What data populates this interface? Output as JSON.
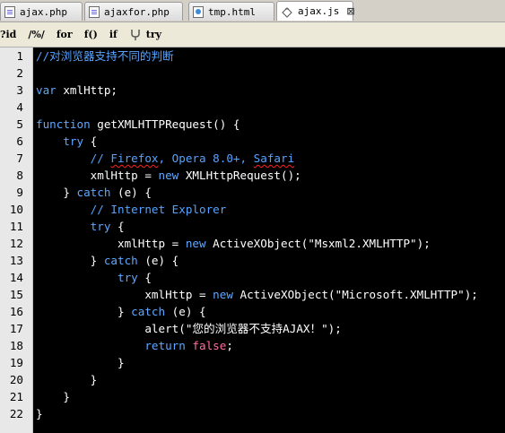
{
  "tabs": [
    {
      "name": "ajax.php",
      "icon": "php-file-icon"
    },
    {
      "name": "ajaxfor.php",
      "icon": "php-file-icon"
    },
    {
      "name": "tmp.html",
      "icon": "html-file-icon"
    },
    {
      "name": "ajax.js",
      "icon": "js-file-icon",
      "active": true,
      "close": "⊠"
    }
  ],
  "toolbar": [
    "?id",
    "/%/",
    "for",
    "f()",
    "if",
    "try"
  ],
  "line_numbers": [
    "1",
    "2",
    "3",
    "4",
    "5",
    "6",
    "7",
    "8",
    "9",
    "10",
    "11",
    "12",
    "13",
    "14",
    "15",
    "16",
    "17",
    "18",
    "19",
    "20",
    "21",
    "22"
  ],
  "code": {
    "l1": "//对浏览器支持不同的判断",
    "l3_kw": "var",
    "l3_rest": " xmlHttp;",
    "l5_kw": "function",
    "l5_rest": " getXMLHTTPRequest() {",
    "l6_kw": "try",
    "l6_rest": " {",
    "l7_a": "// ",
    "l7_b": "Firefox",
    "l7_c": ", Opera 8.0+, ",
    "l7_d": "Safari",
    "l8_a": "xmlHttp = ",
    "l8_kw": "new",
    "l8_b": " XMLHttpRequest();",
    "l9_a": "} ",
    "l9_kw": "catch",
    "l9_b": " (e) {",
    "l10": "// Internet Explorer",
    "l11_kw": "try",
    "l11_rest": " {",
    "l12_a": "xmlHttp = ",
    "l12_kw": "new",
    "l12_b": " ActiveXObject(",
    "l12_str": "\"Msxml2.XMLHTTP\"",
    "l12_c": ");",
    "l13_a": "} ",
    "l13_kw": "catch",
    "l13_b": " (e) {",
    "l14_kw": "try",
    "l14_rest": " {",
    "l15_a": "xmlHttp = ",
    "l15_kw": "new",
    "l15_b": " ActiveXObject(",
    "l15_str": "\"Microsoft.XMLHTTP\"",
    "l15_c": ");",
    "l16_a": "} ",
    "l16_kw": "catch",
    "l16_b": " (e) {",
    "l17_a": "alert(",
    "l17_str": "\"您的浏览器不支持AJAX！\"",
    "l17_b": ");",
    "l18_kw": "return",
    "l18_lit": " false",
    "l18_b": ";",
    "l19": "}",
    "l20": "}",
    "l21": "}",
    "l22": "}"
  },
  "colors": {
    "keyword": "#5fa8ff",
    "comment": "#56a3ff",
    "literal": "#ff6fa3",
    "text": "#ffffff",
    "background": "#000000"
  }
}
